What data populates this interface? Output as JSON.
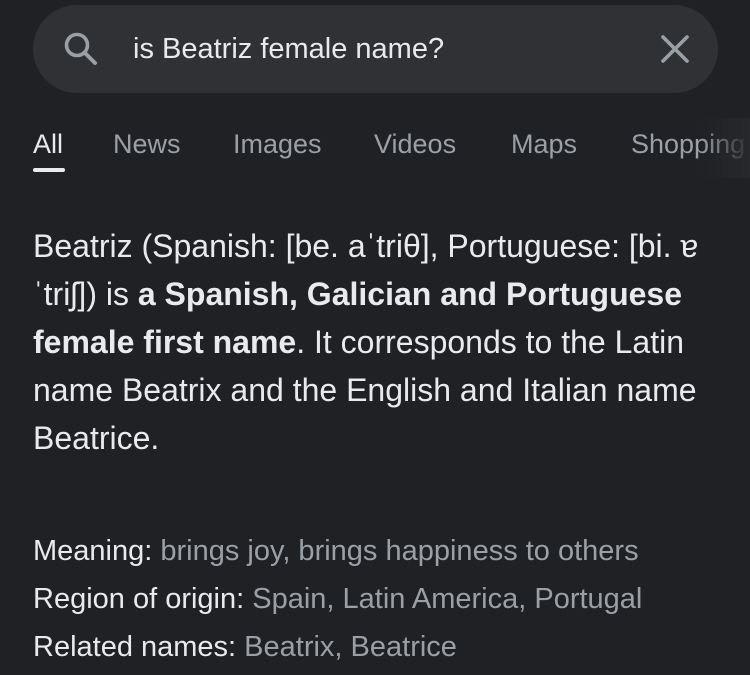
{
  "search": {
    "query": "is Beatriz female name?",
    "search_icon": "search-icon",
    "clear_icon": "close-icon"
  },
  "tabs": [
    {
      "label": "All",
      "active": true
    },
    {
      "label": "News",
      "active": false
    },
    {
      "label": "Images",
      "active": false
    },
    {
      "label": "Videos",
      "active": false
    },
    {
      "label": "Maps",
      "active": false
    },
    {
      "label": "Shopping",
      "active": false
    }
  ],
  "snippet": {
    "text_intro": "Beatriz (Spanish: [be. aˈtriθ], Portuguese: [bi. ɐˈtriʃ]) is ",
    "text_bold": "a Spanish, Galician and Portuguese female first name",
    "text_rest": ". It corresponds to the Latin name Beatrix and the English and Italian name Beatrice."
  },
  "facts": [
    {
      "label": "Meaning: ",
      "value": "brings joy, brings happiness to others"
    },
    {
      "label": "Region of origin: ",
      "value": "Spain, Latin America, Portugal"
    },
    {
      "label": "Related names: ",
      "value": "Beatrix, Beatrice"
    }
  ],
  "colors": {
    "background": "#202124",
    "search_bar": "#303134",
    "primary_text": "#e8eaed",
    "secondary_text": "#9aa0a6"
  }
}
